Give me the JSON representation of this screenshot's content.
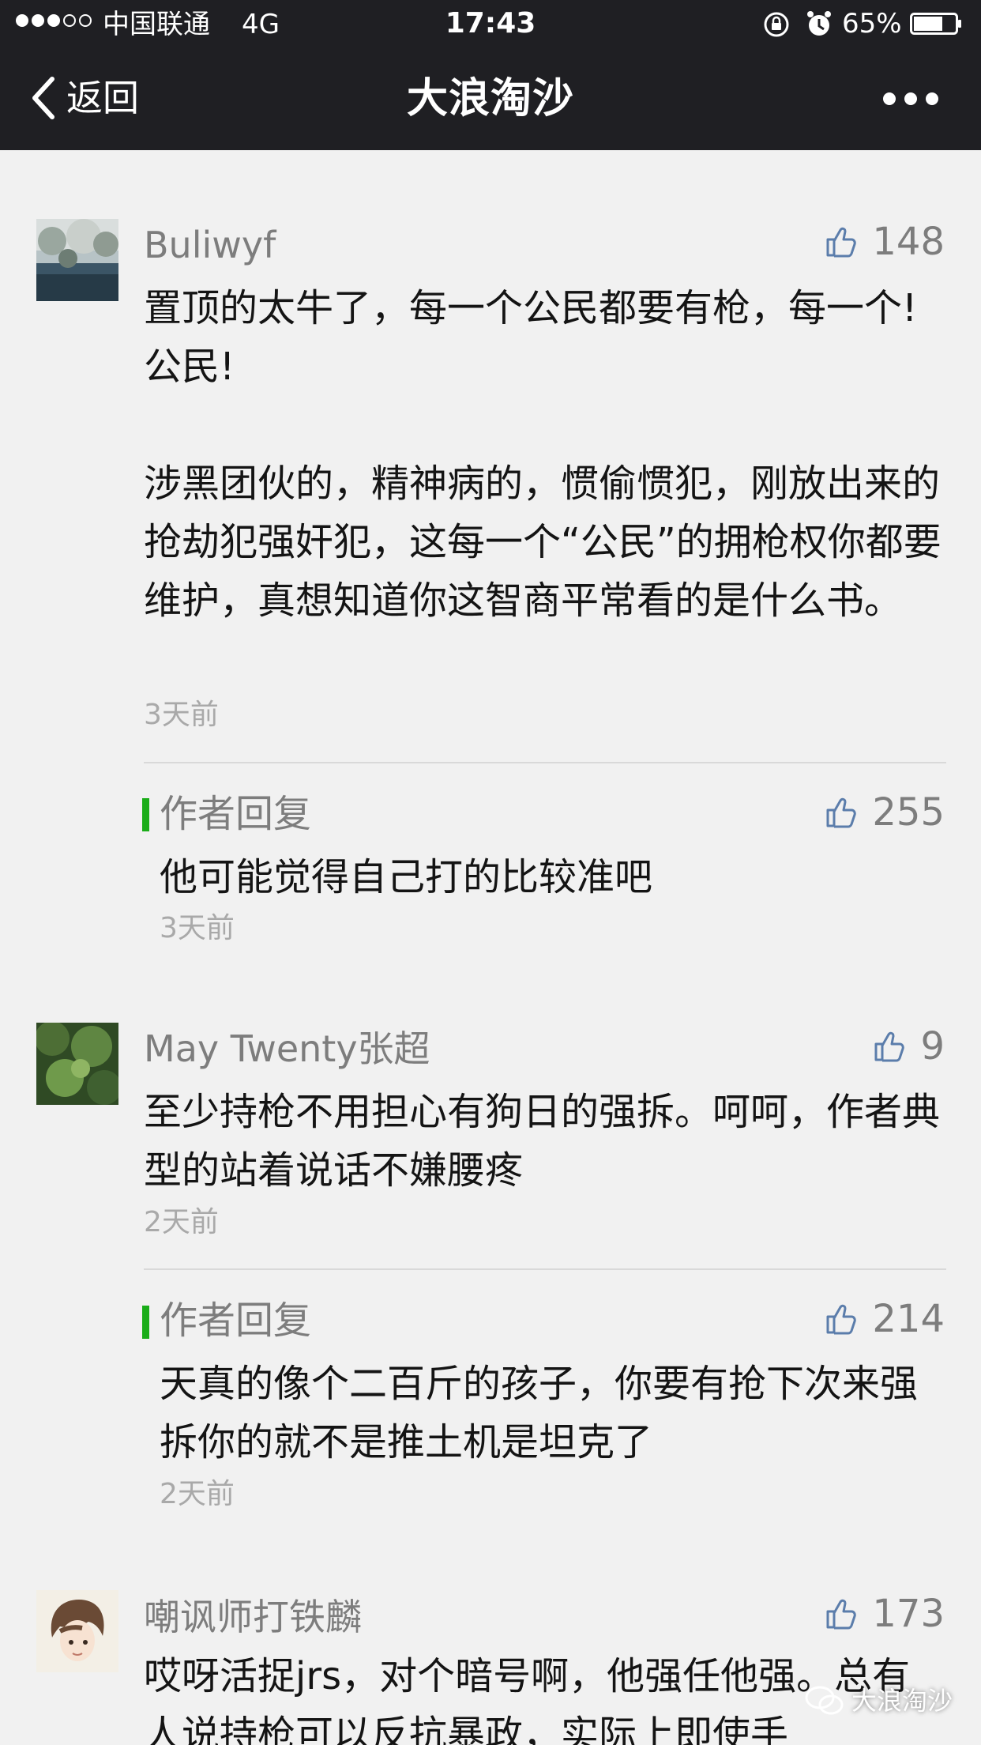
{
  "status_bar": {
    "carrier": "中国联通",
    "network": "4G",
    "time": "17:43",
    "battery": "65%"
  },
  "nav": {
    "back_label": "返回",
    "title": "大浪淘沙"
  },
  "comments": [
    {
      "author": "Buliwyf",
      "likes": "148",
      "paragraphs": [
        "置顶的太牛了，每一个公民都要有枪，每一个!公民!",
        "涉黑团伙的，精神病的，惯偷惯犯，刚放出来的抢劫犯强奸犯，这每一个“公民”的拥枪权你都要维护，真想知道你这智商平常看的是什么书。"
      ],
      "time": "3天前",
      "reply": {
        "title": "作者回复",
        "likes": "255",
        "text": "他可能觉得自己打的比较准吧",
        "time": "3天前"
      }
    },
    {
      "author": "May Twenty张超",
      "likes": "9",
      "paragraphs": [
        "至少持枪不用担心有狗日的强拆。呵呵，作者典型的站着说话不嫌腰疼"
      ],
      "time": "2天前",
      "reply": {
        "title": "作者回复",
        "likes": "214",
        "text": "天真的像个二百斤的孩子，你要有抢下次来强拆你的就不是推土机是坦克了",
        "time": "2天前"
      }
    },
    {
      "author": "嘲讽师打铁麟",
      "likes": "173",
      "paragraphs": [
        "哎呀活捉jrs，对个暗号啊，他强任他强。总有人说持枪可以反抗暴政，实际上即使手"
      ]
    }
  ],
  "watermark": "大浪淘沙",
  "colors": {
    "bar": "#1f1f23",
    "background": "#f1f1f1",
    "reply_accent": "#1aad19",
    "meta_text": "#7d7d7d",
    "like_icon": "#5b7dab"
  }
}
